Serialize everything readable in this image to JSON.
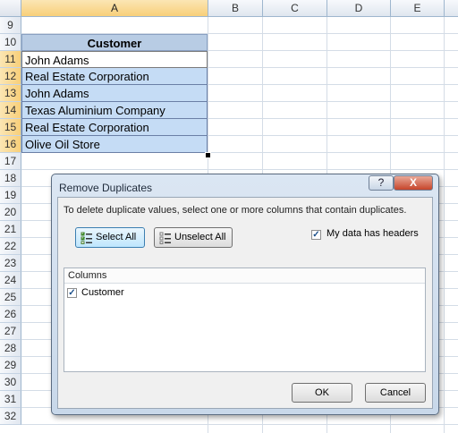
{
  "spreadsheet": {
    "columns": [
      "A",
      "B",
      "C",
      "D",
      "E"
    ],
    "rows": [
      "9",
      "10",
      "11",
      "12",
      "13",
      "14",
      "15",
      "16",
      "17",
      "18",
      "19",
      "20",
      "21",
      "22",
      "23",
      "24",
      "25",
      "26",
      "27",
      "28",
      "29",
      "30",
      "31",
      "32"
    ],
    "header_cell": "Customer",
    "cells": [
      "John Adams",
      "Real Estate Corporation",
      "John Adams",
      "Texas Aluminium Company",
      "Real Estate Corporation",
      "Olive Oil Store"
    ]
  },
  "dialog": {
    "title": "Remove Duplicates",
    "help": "?",
    "close": "X",
    "instructions": "To delete duplicate values, select one or more columns that contain duplicates.",
    "select_all": "Select All",
    "unselect_all": "Unselect All",
    "my_data_has_headers": "My data has headers",
    "my_data_has_headers_checked": true,
    "columns_header": "Columns",
    "columns": [
      {
        "label": "Customer",
        "checked": true
      }
    ],
    "ok": "OK",
    "cancel": "Cancel"
  },
  "colors": {
    "selection_fill": "#c5dcf5",
    "header_fill": "#b8cce4",
    "dialog_frame": "#c8d8ea",
    "close_button": "#c6452b"
  }
}
